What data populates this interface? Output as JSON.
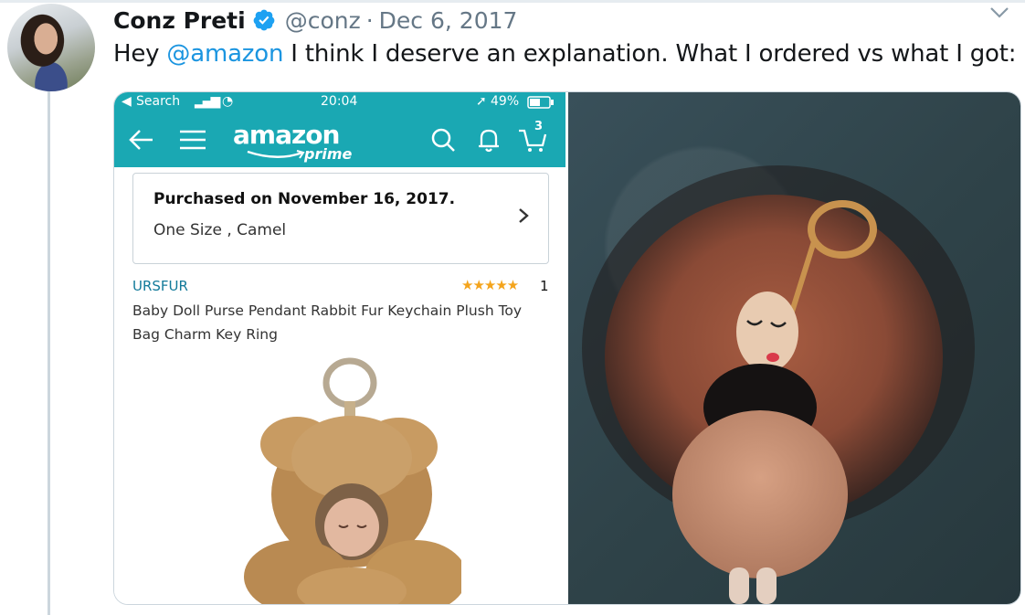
{
  "tweet": {
    "author_name": "Conz Preti",
    "handle": "@conz",
    "separator": "·",
    "date": "Dec 6, 2017",
    "text_before": "Hey ",
    "mention": "@amazon",
    "text_after": " I think I deserve an explanation. What I ordered vs what I got:"
  },
  "phone": {
    "status": {
      "carrier": "Search",
      "time": "20:04",
      "battery": "49%"
    },
    "app": {
      "logo_text": "amazon",
      "logo_sub": "prime",
      "cart_count": "3"
    },
    "order": {
      "purchased_on": "Purchased on November 16, 2017.",
      "variant": "One Size , Camel"
    },
    "product": {
      "brand": "URSFUR",
      "stars": "★★★★★",
      "rating_count": "1",
      "title": "Baby Doll Purse Pendant Rabbit Fur Keychain Plush Toy Bag Charm Key Ring"
    }
  },
  "icons": [
    "verified-badge-icon",
    "chevron-down-icon",
    "back-arrow-icon",
    "menu-icon",
    "search-icon",
    "bell-icon",
    "cart-icon",
    "chevron-right-icon"
  ],
  "colors": {
    "mention": "#1b95e0",
    "amazon_bar": "#1aa8b3",
    "brand_link": "#127a9a",
    "stars": "#f4a41c"
  }
}
